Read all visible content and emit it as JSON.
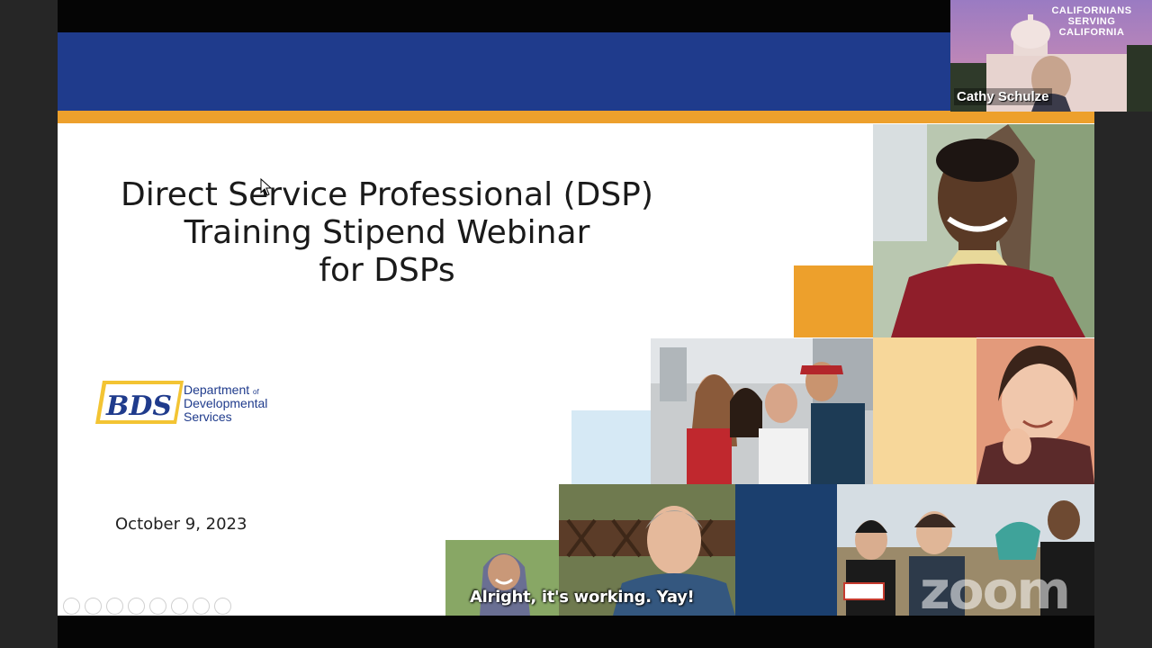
{
  "slide": {
    "title_lines": [
      "Direct Service Professional (DSP)",
      "Training Stipend Webinar",
      "for DSPs"
    ],
    "date": "October 9, 2023",
    "logo": {
      "initials": "BDS",
      "line1": "Department",
      "line1_suffix": "of",
      "line2": "Developmental",
      "line3": "Services"
    }
  },
  "caption": "Alright, it's working. Yay!",
  "watermark": "zoom",
  "speaker": {
    "name": "Cathy Schulze",
    "brand_lines": [
      "CALIFORNIANS",
      "SERVING",
      "CALIFORNIA"
    ]
  },
  "colors": {
    "navy": "#1f3b8c",
    "gold": "#eda02c",
    "dark_blue": "#1b3f6e",
    "pale_gold": "#f7d79a",
    "pale_blue": "#d6e9f5"
  }
}
